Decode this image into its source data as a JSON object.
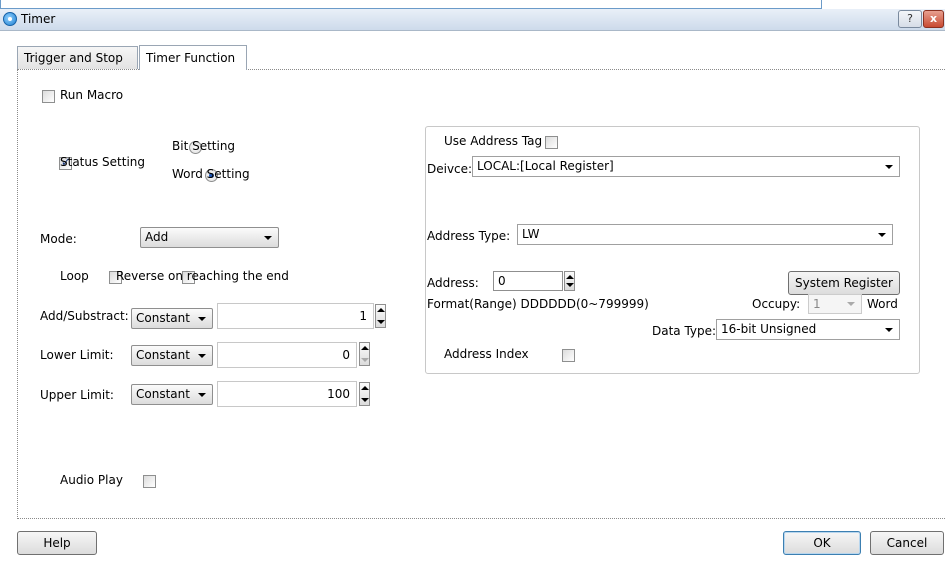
{
  "window": {
    "title": "Timer",
    "help_glyph": "?",
    "close_glyph": "x"
  },
  "tabs": [
    {
      "label": "Trigger and Stop"
    },
    {
      "label": "Timer Function"
    }
  ],
  "run_macro": {
    "label": "Run Macro",
    "checked": false
  },
  "status_setting": {
    "label": "Status Setting",
    "checked": true
  },
  "bit_setting": {
    "label": "Bit Setting",
    "selected": false
  },
  "word_setting": {
    "label": "Word Setting",
    "selected": true
  },
  "mode": {
    "label": "Mode:",
    "value": "Add"
  },
  "loop": {
    "label": "Loop",
    "checked": false
  },
  "reverse": {
    "label": "Reverse on reaching the end",
    "checked": false
  },
  "add_substract": {
    "label": "Add/Substract:",
    "type": "Constant",
    "value": "1"
  },
  "lower_limit": {
    "label": "Lower Limit:",
    "type": "Constant",
    "value": "0"
  },
  "upper_limit": {
    "label": "Upper Limit:",
    "type": "Constant",
    "value": "100"
  },
  "audio_play": {
    "label": "Audio Play",
    "checked": false
  },
  "address_group": {
    "use_address_tag": {
      "label": "Use Address Tag",
      "checked": false
    },
    "device": {
      "label": "Deivce:",
      "value": "LOCAL:[Local Register]"
    },
    "address_type": {
      "label": "Address Type:",
      "value": "LW"
    },
    "address": {
      "label": "Address:",
      "value": "0"
    },
    "system_register_button": "System Register",
    "format_range": "Format(Range)  DDDDDD(0~799999)",
    "occupy": {
      "label": "Occupy:",
      "value": "1",
      "unit": "Word"
    },
    "data_type": {
      "label": "Data Type:",
      "value": "16-bit Unsigned"
    },
    "address_index": {
      "label": "Address Index",
      "checked": false
    }
  },
  "footer": {
    "help": "Help",
    "ok": "OK",
    "cancel": "Cancel"
  }
}
